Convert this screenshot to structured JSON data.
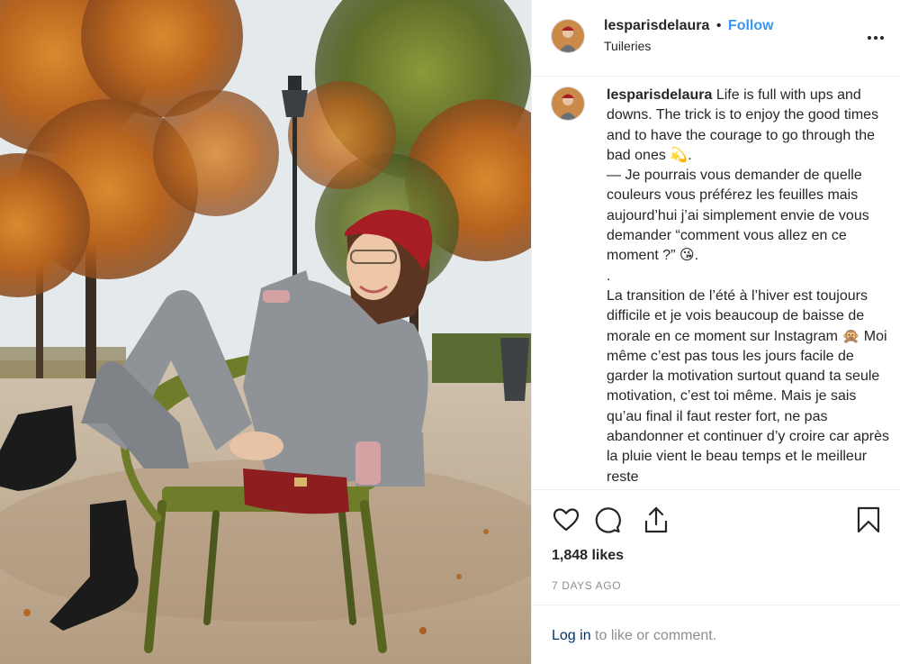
{
  "post": {
    "image": {
      "description": "Woman in grey suit, red beret and red handbag lounging on a green chair under autumn trees in the Tuileries",
      "colors": {
        "foliage": "#c7762a",
        "chair": "#6f7d2b",
        "beret": "#a61d24",
        "bag": "#8d1d1e",
        "suit": "#8f9397",
        "boots": "#1b1b1b"
      }
    },
    "header": {
      "username": "lesparisdelaura",
      "separator": "•",
      "follow_label": "Follow",
      "location": "Tuileries",
      "more_icon": "ellipsis-icon"
    },
    "caption": {
      "username": "lesparisdelaura",
      "text": " Life is full with ups and downs. The trick is to enjoy the good times and to have the courage to go through the bad ones 💫.\n— Je pourrais vous demander de quelle couleurs vous préférez les feuilles mais aujourd’hui j’ai simplement envie de vous demander “comment vous allez en ce moment ?” 😘.\n.\nLa transition de l’été à l’hiver est toujours difficile et je vois beaucoup de baisse de morale en ce moment sur Instagram 🙊 Moi même c’est pas tous les jours facile de garder la motivation surtout quand ta seule motivation, c’est toi même. Mais je sais qu’au final il faut rester fort, ne pas abandonner et continuer d’y croire car après la pluie vient le beau temps et le meilleur reste"
    },
    "actions": {
      "like_icon": "heart-icon",
      "comment_icon": "comment-icon",
      "share_icon": "share-icon",
      "save_icon": "bookmark-icon"
    },
    "likes": "1,848 likes",
    "time_ago": "7 DAYS AGO",
    "login": {
      "link_label": "Log in",
      "suffix": " to like or comment."
    },
    "colors": {
      "link_blue": "#3897f0",
      "login_blue": "#003569",
      "muted": "#8e8e8e",
      "border": "#efefef"
    }
  }
}
